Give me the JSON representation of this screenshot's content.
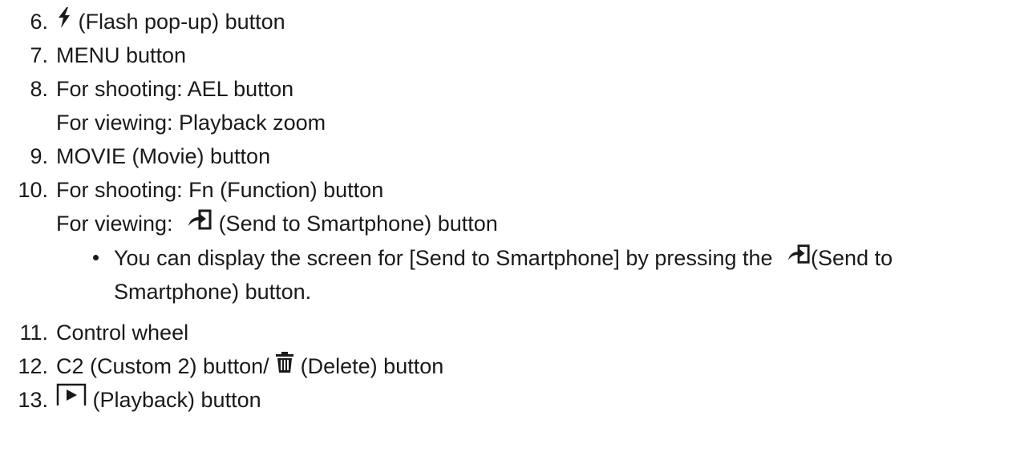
{
  "items": [
    {
      "number": "6.",
      "pre": "",
      "icon": "flash-icon",
      "post": " (Flash pop-up) button"
    },
    {
      "number": "7.",
      "text": "MENU button"
    },
    {
      "number": "8.",
      "lines": [
        "For shooting: AEL button",
        "For viewing: Playback zoom"
      ]
    },
    {
      "number": "9.",
      "text": "MOVIE (Movie) button"
    },
    {
      "number": "10.",
      "line1": "For shooting: Fn (Function) button",
      "line2_pre": "For viewing:",
      "line2_post": " (Send to Smartphone) button",
      "bullet_pre": "You can display the screen for [Send to Smartphone] by pressing the",
      "bullet_post": "(Send to",
      "bullet_line2": "Smartphone) button."
    },
    {
      "number": "11.",
      "text": "Control wheel"
    },
    {
      "number": "12.",
      "pre": "C2 (Custom 2) button/",
      "post": " (Delete) button"
    },
    {
      "number": "13.",
      "post": " (Playback) button"
    }
  ],
  "icons": {
    "flash": "flash-icon",
    "send": "send-to-smartphone-icon",
    "delete": "trash-icon",
    "playback": "playback-icon"
  },
  "colors": {
    "text": "#1a1a1a"
  }
}
